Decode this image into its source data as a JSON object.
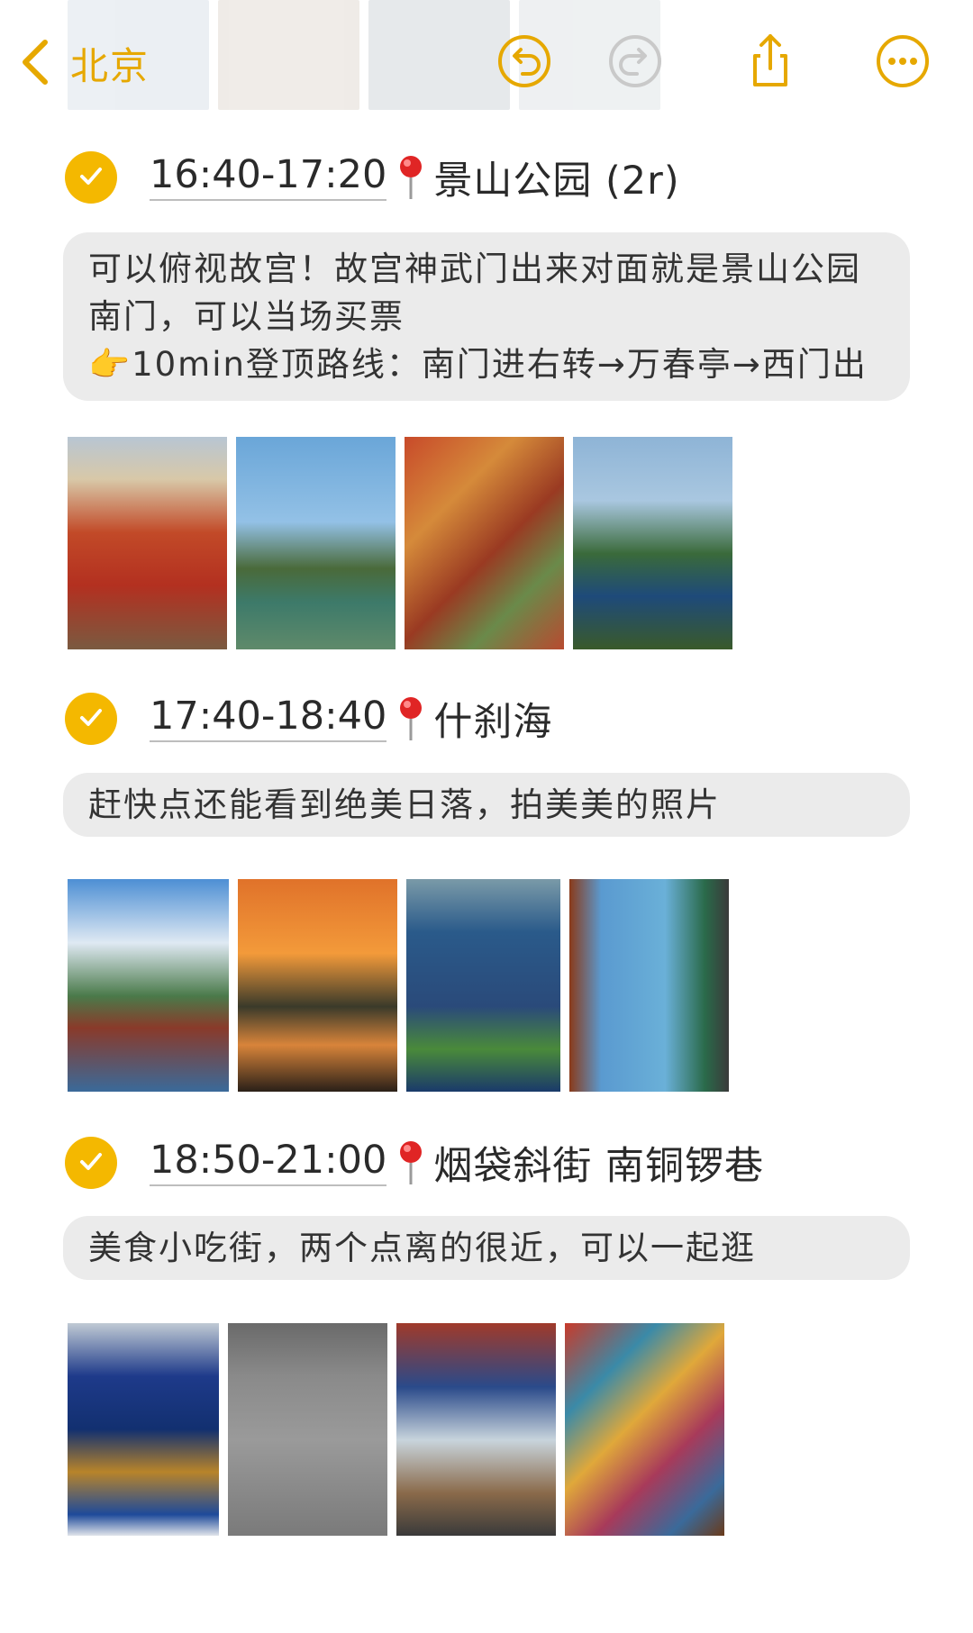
{
  "nav": {
    "back_label": "北京",
    "icons": [
      "chevron-left-icon",
      "undo-icon",
      "redo-icon",
      "share-icon",
      "more-icon"
    ]
  },
  "accent_color": "#f4b800",
  "sections": [
    {
      "time": "16:40-17:20",
      "place": "景山公园 (2r)",
      "note": [
        "可以俯视故宫！故宫神武门出来对面就是景山公园",
        "南门，可以当场买票",
        "👉10min登顶路线：南门进右转→万春亭→西门出"
      ],
      "photos": [
        "forbidden-city-overview-photo",
        "corner-tower-moat-photo",
        "palace-rooftops-photo",
        "wanchun-pavilion-photo"
      ]
    },
    {
      "time": "17:40-18:40",
      "place": "什刹海",
      "note": [
        "赶快点还能看到绝美日落，拍美美的照片"
      ],
      "photos": [
        "lakeside-pagoda-photo",
        "sunset-boats-photo",
        "lotus-leaves-photo",
        "lake-view-window-photo"
      ]
    },
    {
      "time": "18:50-21:00",
      "place": "烟袋斜街 南铜锣巷",
      "note": [
        "美食小吃街，两个点离的很近，可以一起逛"
      ],
      "photos": [
        "yandai-xiejie-gate-photo",
        "street-map-relief-photo",
        "painted-archway-photo",
        "fridge-magnets-photo"
      ]
    }
  ]
}
